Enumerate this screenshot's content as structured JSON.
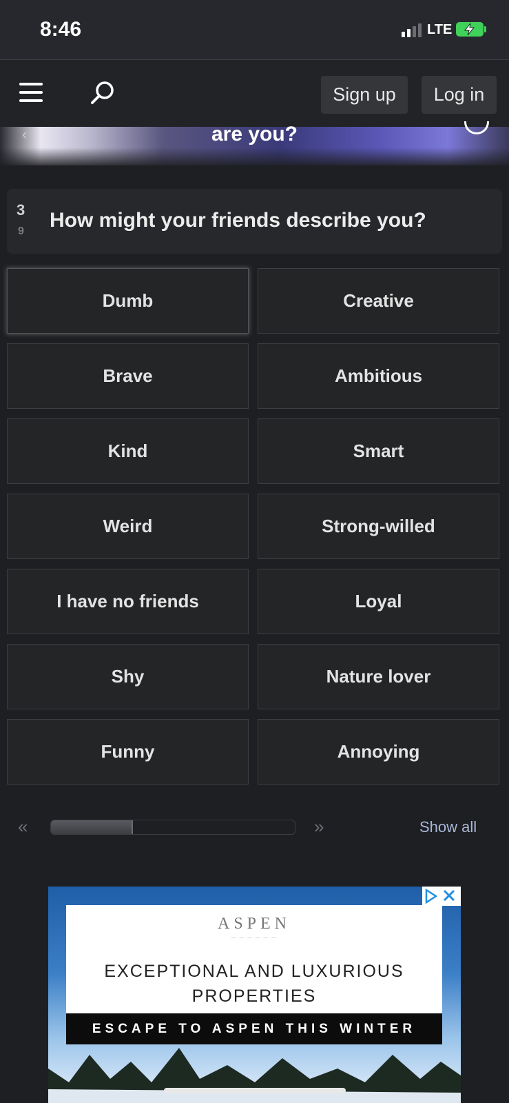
{
  "status_bar": {
    "time": "8:46",
    "network": "LTE"
  },
  "header": {
    "signup_label": "Sign up",
    "login_label": "Log in"
  },
  "hero": {
    "title": "are you?"
  },
  "question": {
    "number": "3",
    "total": "9",
    "text": "How might your friends describe you?"
  },
  "answers": [
    {
      "label": "Dumb",
      "selected": true
    },
    {
      "label": "Creative"
    },
    {
      "label": "Brave"
    },
    {
      "label": "Ambitious"
    },
    {
      "label": "Kind"
    },
    {
      "label": "Smart"
    },
    {
      "label": "Weird"
    },
    {
      "label": "Strong-willed"
    },
    {
      "label": "I have no friends"
    },
    {
      "label": "Loyal"
    },
    {
      "label": "Shy"
    },
    {
      "label": "Nature lover"
    },
    {
      "label": "Funny"
    },
    {
      "label": "Annoying"
    }
  ],
  "pagination": {
    "prev": "«",
    "next": "»",
    "show_all": "Show all",
    "progress_fraction": 0.33
  },
  "ad": {
    "brand": "ASPEN",
    "headline_1": "EXCEPTIONAL AND LUXURIOUS",
    "headline_2": "PROPERTIES",
    "strip": "ESCAPE TO ASPEN THIS WINTER"
  },
  "colors": {
    "battery": "#3fd15a",
    "show_all_link": "#a8b7d8"
  }
}
